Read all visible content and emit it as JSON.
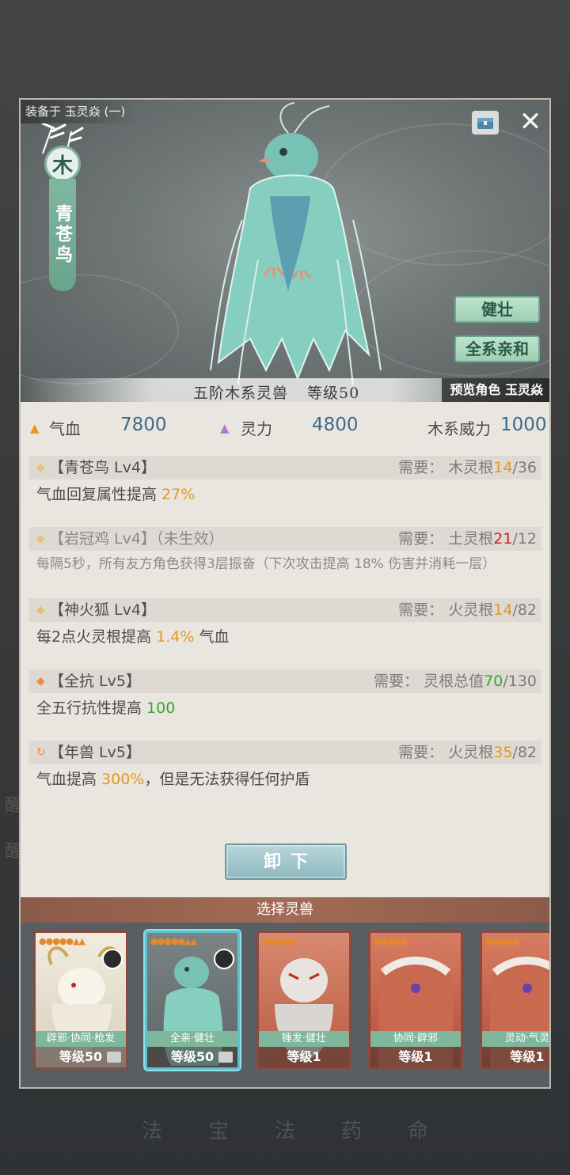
{
  "background": {
    "bottom_tabs": [
      "法",
      "宝",
      "法",
      "药",
      "命"
    ],
    "side_chars": [
      "醒",
      "醒"
    ]
  },
  "header": {
    "equipped_to": "装备于 玉灵焱 (一)",
    "element": "木",
    "beast_name": "青苍鸟",
    "close_icon": "close-icon",
    "trait_buttons": [
      "健壮",
      "全系亲和"
    ],
    "tier": "五阶木系灵兽",
    "level": "等级50",
    "preview": "预览角色 玉灵焱"
  },
  "stats": {
    "hp_label": "气血",
    "hp_value": "7800",
    "spirit_label": "灵力",
    "spirit_value": "4800",
    "power_label": "木系威力",
    "power_value": "1000"
  },
  "skills": [
    {
      "title": "【青苍鸟 Lv4】",
      "req_label": "需要：",
      "req_type": "木灵根",
      "req_current": "14",
      "req_total": "/36",
      "desc_pre": "气血回复属性提高 ",
      "desc_highlight": "27%",
      "desc_post": ""
    },
    {
      "title": "【岩冠鸡 Lv4】（未生效）",
      "req_label": "需要：",
      "req_type": "土灵根",
      "req_current": "21",
      "req_total": "/12",
      "desc_pre": "每隔5秒，所有友方角色获得3层振奋（下次攻击提高 18% 伤害并消耗一层）",
      "desc_highlight": "",
      "desc_post": ""
    },
    {
      "title": "【神火狐 Lv4】",
      "req_label": "需要：",
      "req_type": "火灵根",
      "req_current": "14",
      "req_total": "/82",
      "desc_pre": "每2点火灵根提高 ",
      "desc_highlight": "1.4%",
      "desc_post": " 气血"
    },
    {
      "title": "【全抗 Lv5】",
      "req_label": "需要：",
      "req_type": "灵根总值",
      "req_current": "70",
      "req_total": "/130",
      "desc_pre": "全五行抗性提高 ",
      "desc_highlight": "100",
      "desc_post": ""
    },
    {
      "title": "【年兽 Lv5】",
      "req_label": "需要：",
      "req_type": "火灵根",
      "req_current": "35",
      "req_total": "/82",
      "desc_pre": "气血提高 ",
      "desc_highlight": "300%",
      "desc_post": "，但是无法获得任何护盾"
    }
  ],
  "unequip_label": "卸下",
  "select_title": "选择灵兽",
  "pets": [
    {
      "tags": "辟邪·协同·枪发",
      "level": "等级50"
    },
    {
      "tags": "全亲·健壮",
      "level": "等级50"
    },
    {
      "tags": "锤发·健壮",
      "level": "等级1"
    },
    {
      "tags": "协同·辟邪",
      "level": "等级1"
    },
    {
      "tags": "灵动·气灵",
      "level": "等级1"
    }
  ],
  "colors": {
    "accent_orange": "#e6961e",
    "accent_red": "#c0281e",
    "accent_green": "#3aa632",
    "stat_blue": "#3d6b8b",
    "wood_green": "#7fb39d"
  }
}
